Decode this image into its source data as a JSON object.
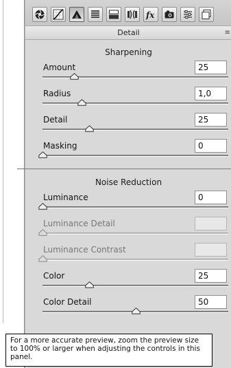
{
  "toolbar": {
    "buttons": [
      {
        "icon": "basic-aperture-icon",
        "active": false
      },
      {
        "icon": "tone-curve-icon",
        "active": false
      },
      {
        "icon": "detail-triangle-icon",
        "active": true
      },
      {
        "icon": "hsl-grayscale-icon",
        "active": false
      },
      {
        "icon": "split-toning-icon",
        "active": false
      },
      {
        "icon": "lens-corrections-icon",
        "active": false
      },
      {
        "icon": "fx-effects-icon",
        "active": false
      },
      {
        "icon": "camera-calibration-icon",
        "active": false
      },
      {
        "icon": "presets-icon",
        "active": false
      },
      {
        "icon": "snapshots-icon",
        "active": false
      }
    ]
  },
  "panel": {
    "title": "Detail",
    "menu_glyph": "≡"
  },
  "sharpening": {
    "title": "Sharpening",
    "controls": [
      {
        "label": "Amount",
        "value": "25",
        "position": 0.17,
        "enabled": true
      },
      {
        "label": "Radius",
        "value": "1,0",
        "position": 0.21,
        "enabled": true
      },
      {
        "label": "Detail",
        "value": "25",
        "position": 0.25,
        "enabled": true
      },
      {
        "label": "Masking",
        "value": "0",
        "position": 0.0,
        "enabled": true
      }
    ]
  },
  "noise_reduction": {
    "title": "Noise Reduction",
    "controls": [
      {
        "label": "Luminance",
        "value": "0",
        "position": 0.0,
        "enabled": true
      },
      {
        "label": "Luminance Detail",
        "value": "",
        "position": 0.0,
        "enabled": false
      },
      {
        "label": "Luminance Contrast",
        "value": "",
        "position": 0.0,
        "enabled": false
      },
      {
        "label": "Color",
        "value": "25",
        "position": 0.25,
        "enabled": true
      },
      {
        "label": "Color Detail",
        "value": "50",
        "position": 0.5,
        "enabled": true
      }
    ]
  },
  "tooltip": {
    "text": "For a more accurate preview, zoom the preview size to 100% or larger when adjusting the controls in this panel."
  }
}
